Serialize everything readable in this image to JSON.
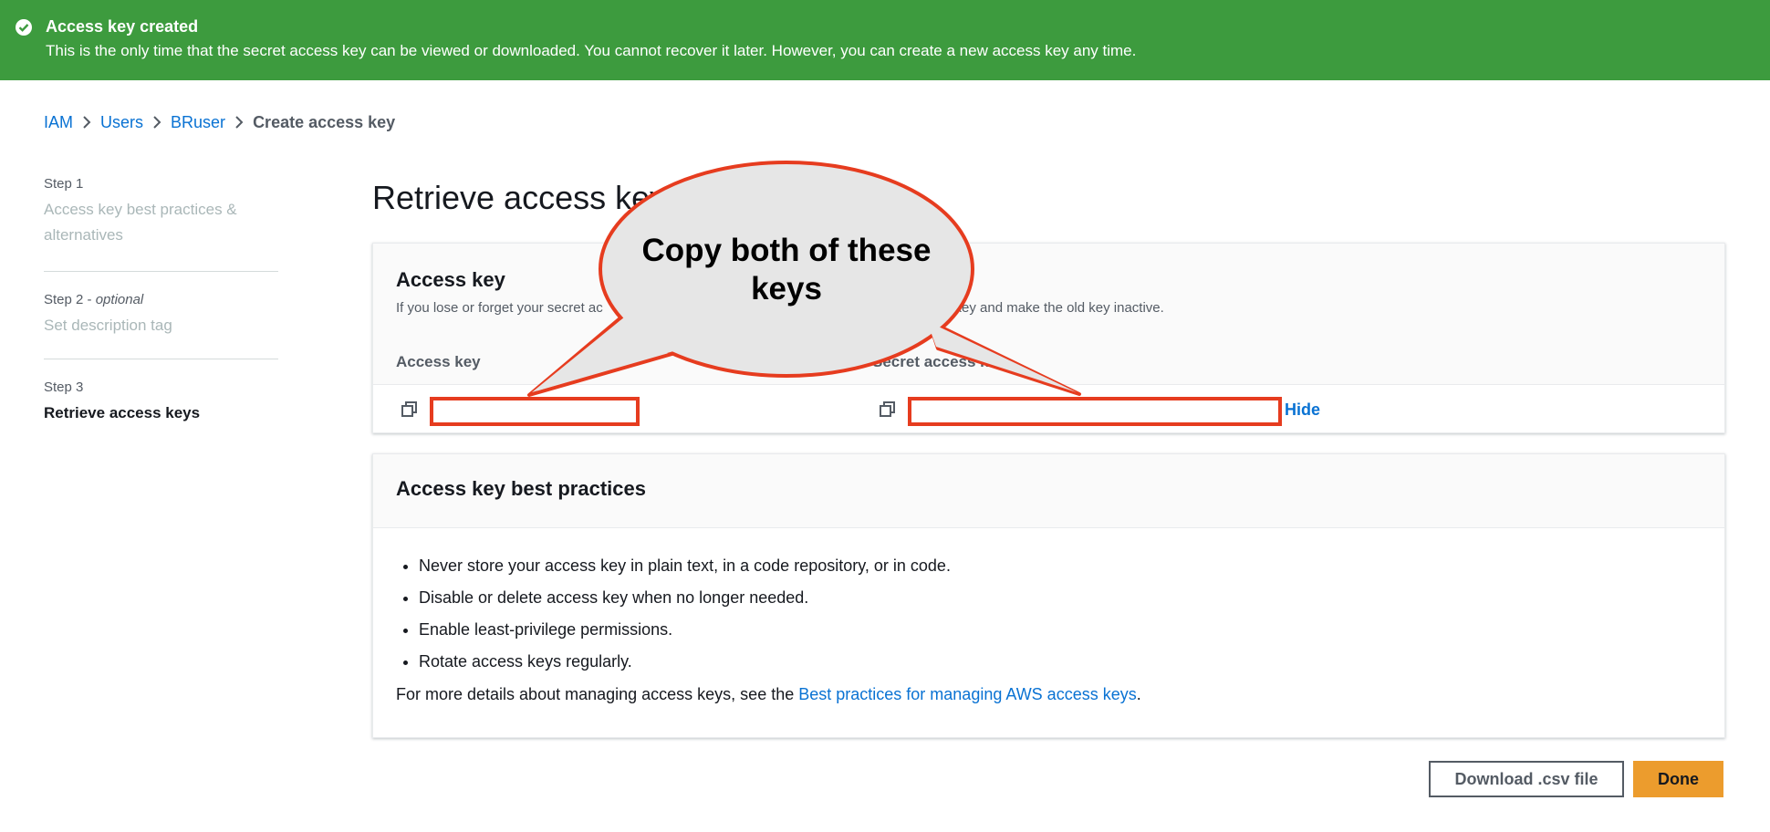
{
  "banner": {
    "title": "Access key created",
    "message": "This is the only time that the secret access key can be viewed or downloaded. You cannot recover it later. However, you can create a new access key any time."
  },
  "breadcrumb": {
    "items": [
      "IAM",
      "Users",
      "BRuser"
    ],
    "current": "Create access key"
  },
  "steps": [
    {
      "label": "Step 1",
      "name": "Access key best practices & alternatives"
    },
    {
      "label": "Step 2",
      "optional": "optional",
      "name": "Set description tag"
    },
    {
      "label": "Step 3",
      "name": "Retrieve access keys"
    }
  ],
  "page": {
    "title": "Retrieve access keys"
  },
  "access_key_panel": {
    "title": "Access key",
    "desc_left": "If you lose or forget your secret ac",
    "desc_right": "ccess key and make the old key inactive.",
    "col_access_key": "Access key",
    "col_secret": "Secret access key",
    "hide_label": "Hide"
  },
  "best_practices": {
    "title": "Access key best practices",
    "items": [
      "Never store your access key in plain text, in a code repository, or in code.",
      "Disable or delete access key when no longer needed.",
      "Enable least-privilege permissions.",
      "Rotate access keys regularly."
    ],
    "more_prefix": "For more details about managing access keys, see the ",
    "more_link": "Best practices for managing AWS access keys",
    "more_suffix": "."
  },
  "buttons": {
    "download_csv": "Download .csv file",
    "done": "Done"
  },
  "annotation": {
    "line1": "Copy both of these",
    "line2": "keys"
  },
  "colors": {
    "banner": "#3d9b3e",
    "link": "#0972d3",
    "primary": "#ec9c2d",
    "highlight": "#e63c1f",
    "bubble": "#e6e6e6"
  }
}
